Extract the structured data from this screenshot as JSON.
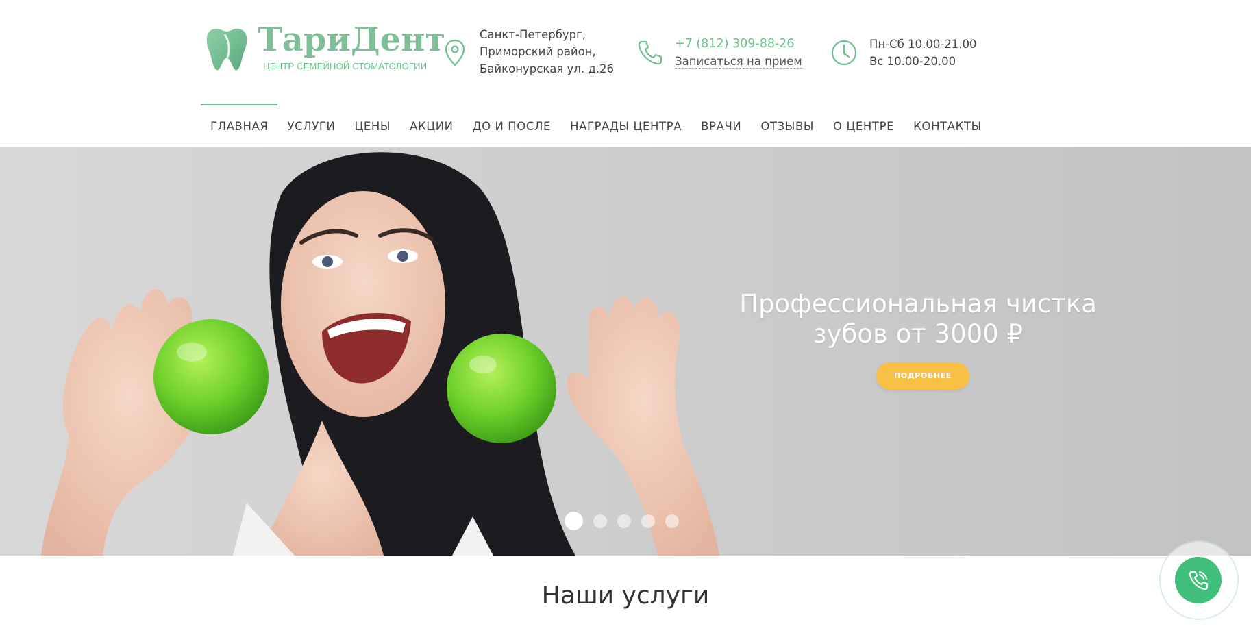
{
  "logo": {
    "name": "ТариДент",
    "subtitle": "ЦЕНТР СЕМЕЙНОЙ СТОМАТОЛОГИИ"
  },
  "contacts": {
    "address_lines": [
      "Санкт-Петербург,",
      "Приморский район,",
      "Байконурская ул. д.26"
    ],
    "phone": "+7 (812) 309-88-26",
    "book_link": "Записаться на прием",
    "hours_lines": [
      "Пн-Сб 10.00-21.00",
      "Вс 10.00-20.00"
    ]
  },
  "nav": {
    "items": [
      "ГЛАВНАЯ",
      "УСЛУГИ",
      "ЦЕНЫ",
      "АКЦИИ",
      "ДО И ПОСЛЕ",
      "НАГРАДЫ ЦЕНТРА",
      "ВРАЧИ",
      "ОТЗЫВЫ",
      "О ЦЕНТРЕ",
      "КОНТАКТЫ"
    ],
    "active": "ГЛАВНАЯ"
  },
  "hero": {
    "title_line1": "Профессиональная чистка",
    "title_line2": "зубов от 3000 ₽",
    "button_label": "ПОДРОБНЕЕ",
    "slides_count": 5,
    "active_slide": 1
  },
  "services": {
    "title": "Наши услуги"
  },
  "colors": {
    "brand_green": "#6cc08e",
    "button_yellow": "#f9c046",
    "callback_green": "#3fbf79"
  },
  "icons": {
    "address": "map-pin-icon",
    "phone": "phone-icon",
    "hours": "clock-icon",
    "callback": "phone-ring-icon"
  }
}
